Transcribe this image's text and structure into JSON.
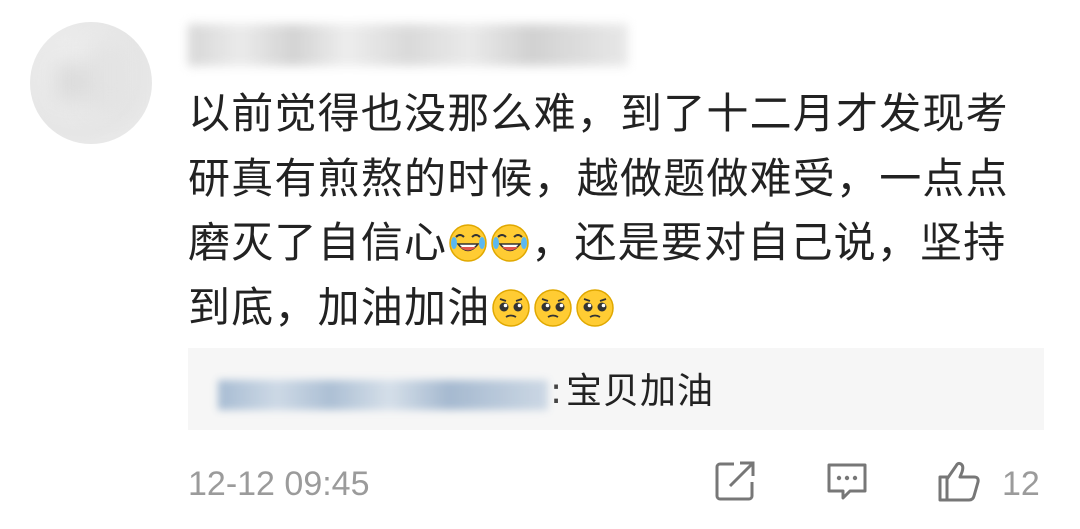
{
  "comment": {
    "segments": [
      {
        "text": "以前觉得也没那么难，到了十二月才发现考研真有煎熬的时候，越做题做难受，一点点磨灭了自信心"
      },
      {
        "emoji": "laughing-crying"
      },
      {
        "emoji": "laughing-crying"
      },
      {
        "text": "，还是要对自己说，坚持到底，加油加油"
      },
      {
        "emoji": "pleading-face"
      },
      {
        "emoji": "pleading-face"
      },
      {
        "emoji": "pleading-face"
      }
    ]
  },
  "reply": {
    "colon": ":",
    "text": "宝贝加油"
  },
  "timestamp": "12-12 09:45",
  "actions": {
    "like_count": "12"
  },
  "icons": [
    "share-icon",
    "comment-icon",
    "thumbs-up-icon",
    "laughing-crying-emoji",
    "pleading-face-emoji"
  ],
  "colors": {
    "text": "#222222",
    "meta": "#9b9b9b",
    "reply_bg": "#f6f6f6",
    "emoji_face": "#ffcc33"
  }
}
